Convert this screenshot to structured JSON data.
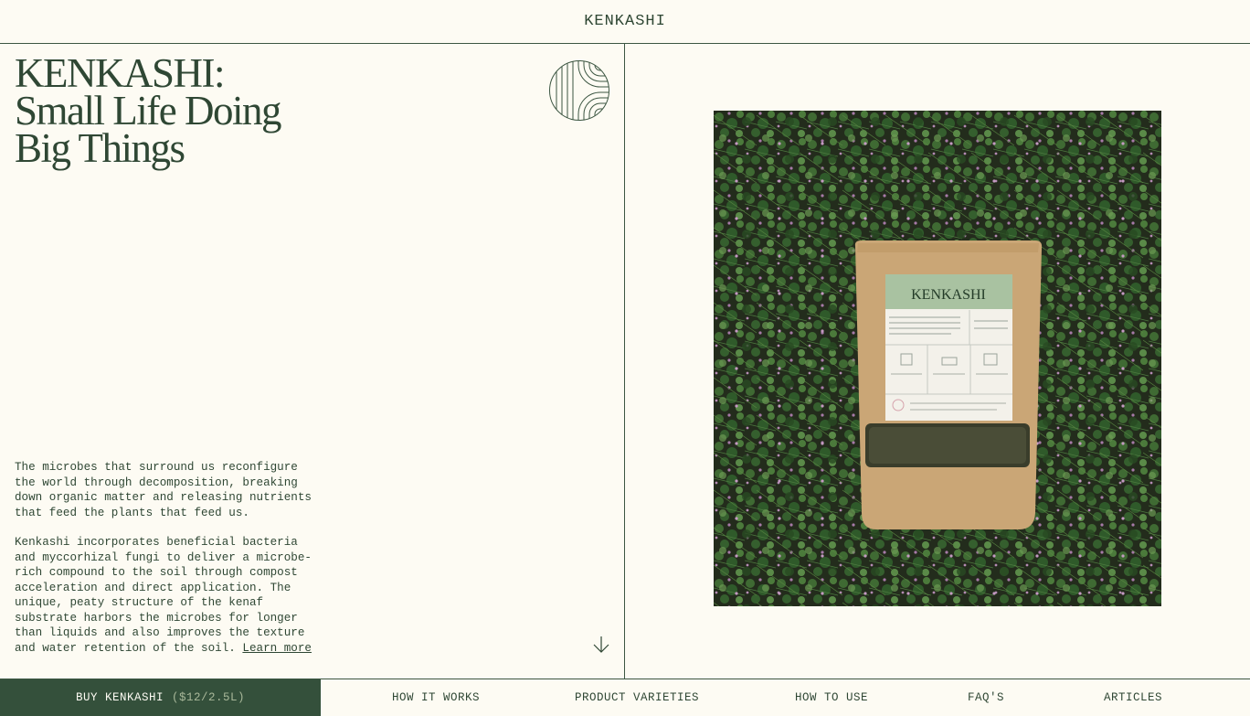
{
  "header": {
    "brand": "KENKASHI"
  },
  "hero": {
    "headline_lines": [
      "KENKASHI:",
      "Small Life Doing",
      "Big Things"
    ],
    "paragraph_1": "The microbes that surround us reconfigure the world through decomposition, breaking down organic matter and releasing nutrients that feed the plants that feed us.",
    "paragraph_2": "Kenkashi incorporates beneficial bacteria and myccorhizal fungi to deliver a microbe-rich compound to the soil through compost acceleration and direct application. The unique, peaty structure of the kenaf substrate harbors the microbes for longer than liquids and also improves the texture and water retention of the soil.",
    "learn_more": "Learn more"
  },
  "product_photo": {
    "label_brand": "KENKASHI",
    "icons": [
      "circle-logo-icon",
      "arrow-down-icon"
    ]
  },
  "bottom_nav": {
    "buy_label": "BUY KENKASHI",
    "buy_price": "($12/2.5L)",
    "items": [
      "HOW IT WORKS",
      "PRODUCT VARIETIES",
      "HOW TO USE",
      "FAQ'S",
      "ARTICLES"
    ]
  },
  "colors": {
    "background": "#fdfbf3",
    "primary": "#2f4734",
    "buy_bg": "#34503b",
    "price": "#a9b89a"
  }
}
